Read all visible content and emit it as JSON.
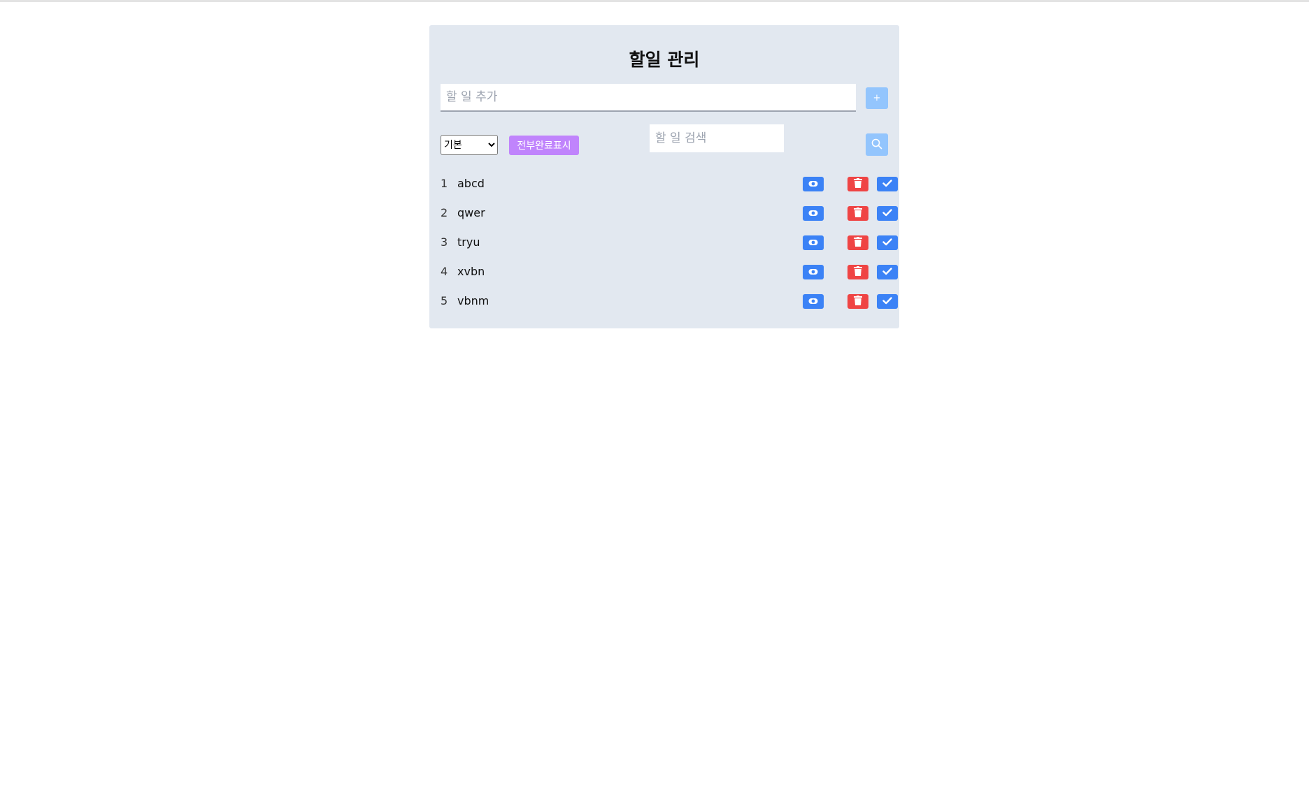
{
  "title": "할일 관리",
  "add": {
    "placeholder": "할 일 추가",
    "button_label": "+"
  },
  "controls": {
    "sort_selected": "기본",
    "complete_all_label": "전부완료표시",
    "search_placeholder": "할 일 검색"
  },
  "todos": [
    {
      "num": "1",
      "text": "abcd"
    },
    {
      "num": "2",
      "text": "qwer"
    },
    {
      "num": "3",
      "text": "tryu"
    },
    {
      "num": "4",
      "text": "xvbn"
    },
    {
      "num": "5",
      "text": "vbnm"
    }
  ],
  "icons": {
    "view": "eye-icon",
    "delete": "trash-icon",
    "complete": "check-icon",
    "search": "search-icon"
  },
  "colors": {
    "panel_bg": "#e2e8f0",
    "primary": "#3b82f6",
    "danger": "#ef4444",
    "accent_purple": "#c084fc",
    "light_blue": "#93c5fd"
  }
}
